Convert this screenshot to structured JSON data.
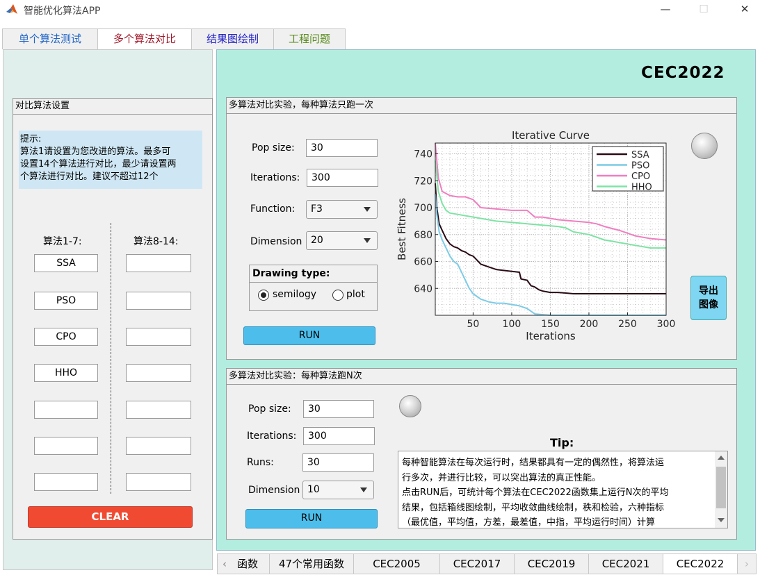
{
  "window": {
    "title": "智能优化算法APP",
    "minimize": "—",
    "maximize": "☐",
    "close": "✕"
  },
  "main_tabs": [
    {
      "label": "单个算法测试",
      "color": "#1f64c8"
    },
    {
      "label": "多个算法对比",
      "color": "#a0182a"
    },
    {
      "label": "结果图绘制",
      "color": "#1e1ec8"
    },
    {
      "label": "工程问题",
      "color": "#5a8c1e"
    }
  ],
  "left": {
    "title": "对比算法设置",
    "hint": [
      "提示:",
      "算法1请设置为您改进的算法。最多可",
      "设置14个算法进行对比，最少请设置两",
      "个算法进行对比。建议不超过12个"
    ],
    "col1_label": "算法1-7:",
    "col2_label": "算法8-14:",
    "col1_values": [
      "SSA",
      "PSO",
      "CPO",
      "HHO",
      "",
      "",
      ""
    ],
    "col2_values": [
      "",
      "",
      "",
      "",
      "",
      "",
      ""
    ],
    "clear_label": "CLEAR"
  },
  "suite_title": "CEC2022",
  "single": {
    "title": "多算法对比实验，每种算法只跑一次",
    "pop_label": "Pop size:",
    "pop_value": "30",
    "iter_label": "Iterations:",
    "iter_value": "300",
    "func_label": "Function:",
    "func_value": "F3",
    "dim_label": "Dimension",
    "dim_value": "20",
    "draw_title": "Drawing type:",
    "opt_semilogy": "semilogy",
    "opt_plot": "plot",
    "selected": "semilogy",
    "run_label": "RUN",
    "export_label_1": "导出",
    "export_label_2": "图像"
  },
  "chart_data": {
    "type": "line",
    "title": "Iterative Curve",
    "xlabel": "Iterations",
    "ylabel": "Best Fitness",
    "xlim": [
      1,
      300
    ],
    "ylim": [
      620,
      748
    ],
    "xticks": [
      50,
      100,
      150,
      200,
      250,
      300
    ],
    "yticks": [
      640,
      660,
      680,
      700,
      720,
      740
    ],
    "grid": true,
    "legend_position": "top-right",
    "series": [
      {
        "name": "SSA",
        "color": "#2a0a14",
        "x": [
          1,
          3,
          6,
          10,
          15,
          20,
          25,
          30,
          35,
          40,
          45,
          50,
          55,
          60,
          70,
          80,
          95,
          110,
          112,
          120,
          125,
          130,
          135,
          140,
          150,
          160,
          170,
          180,
          190,
          200,
          210,
          230,
          250,
          270,
          300
        ],
        "y": [
          718,
          700,
          688,
          683,
          677,
          673,
          671,
          670,
          668,
          667,
          665,
          664,
          661,
          658,
          656,
          654,
          653,
          652,
          647,
          646,
          642,
          641,
          639,
          638,
          637,
          637,
          636.5,
          636,
          636,
          636,
          636,
          636,
          636,
          636,
          636
        ]
      },
      {
        "name": "PSO",
        "color": "#7ccbe6",
        "x": [
          1,
          3,
          6,
          10,
          15,
          20,
          25,
          30,
          35,
          40,
          45,
          50,
          60,
          70,
          80,
          90,
          100,
          110,
          120,
          125,
          130,
          150,
          200,
          300
        ],
        "y": [
          710,
          695,
          682,
          676,
          670,
          664,
          660,
          658,
          652,
          646,
          640,
          636,
          632,
          630,
          629,
          629,
          628,
          627,
          625,
          623,
          621,
          620,
          620,
          620
        ]
      },
      {
        "name": "CPO",
        "color": "#f07ec0",
        "x": [
          1,
          5,
          10,
          20,
          30,
          40,
          50,
          60,
          80,
          100,
          120,
          130,
          140,
          150,
          160,
          180,
          200,
          210,
          220,
          240,
          260,
          280,
          300
        ],
        "y": [
          748,
          722,
          712,
          709,
          708,
          708,
          706,
          700,
          699,
          698,
          698,
          693,
          693,
          692,
          691,
          690,
          689,
          688,
          686,
          683,
          679,
          677,
          676
        ]
      },
      {
        "name": "HHO",
        "color": "#7ee3a4",
        "x": [
          1,
          5,
          10,
          15,
          20,
          30,
          40,
          60,
          80,
          100,
          120,
          140,
          160,
          170,
          180,
          200,
          210,
          220,
          240,
          260,
          280,
          300
        ],
        "y": [
          735,
          712,
          703,
          698,
          696,
          695,
          694,
          692,
          690,
          689,
          688,
          687,
          686,
          685,
          682,
          680,
          678,
          676,
          674,
          672,
          670,
          670
        ]
      }
    ]
  },
  "multi": {
    "title": "多算法对比实验：每种算法跑N次",
    "pop_label": "Pop size:",
    "pop_value": "30",
    "iter_label": "Iterations:",
    "iter_value": "300",
    "runs_label": "Runs:",
    "runs_value": "30",
    "dim_label": "Dimension",
    "dim_value": "10",
    "run_label": "RUN",
    "tip_title": "Tip:",
    "tip_lines": [
      "每种智能算法在每次运行时，结果都具有一定的偶然性，将算法运",
      "行多次，并进行比较，可以突出算法的真正性能。",
      "点击RUN后，可统计每个算法在CEC2022函数集上运行N次的平均",
      "结果，包括箱线图绘制，平均收敛曲线绘制，秩和检验，六种指标",
      "（最优值，平均值，方差，最差值，中指，平均运行时间）计算"
    ]
  },
  "bottom_tabs": [
    "函数",
    "47个常用函数",
    "CEC2005",
    "CEC2017",
    "CEC2019",
    "CEC2021",
    "CEC2022"
  ],
  "bottom_active": "CEC2022",
  "colors": {
    "left_bg": "#e1efec",
    "right_bg": "#b3ede0",
    "run_button": "#4dbeeb",
    "clear_button": "#f04b32",
    "export_button": "#7fd6f2"
  }
}
